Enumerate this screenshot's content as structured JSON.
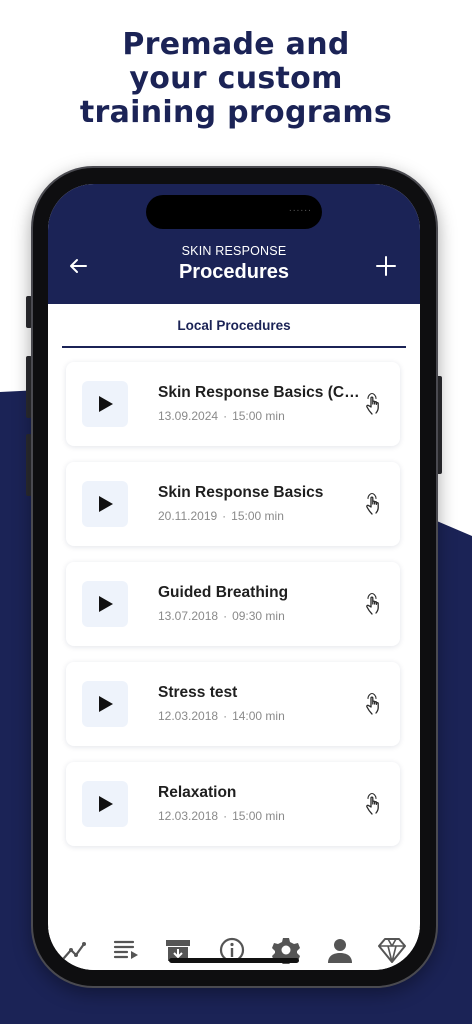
{
  "headline": [
    "Premade and",
    "your custom",
    "training programs"
  ],
  "header": {
    "subtitle": "SKIN RESPONSE",
    "title": "Procedures",
    "back_icon": "arrow-left-icon",
    "add_icon": "plus-icon"
  },
  "tabs": [
    {
      "label": "Local Procedures",
      "selected": true
    }
  ],
  "procedures": [
    {
      "title": "Skin Response Basics (CO...",
      "date": "13.09.2024",
      "duration": "15:00 min"
    },
    {
      "title": "Skin Response Basics",
      "date": "20.11.2019",
      "duration": "15:00 min"
    },
    {
      "title": "Guided Breathing",
      "date": "13.07.2018",
      "duration": "09:30 min"
    },
    {
      "title": "Stress test",
      "date": "12.03.2018",
      "duration": "14:00 min"
    },
    {
      "title": "Relaxation",
      "date": "12.03.2018",
      "duration": "15:00 min"
    }
  ],
  "meta_separator": "·",
  "bottom_nav": [
    "trend-icon",
    "playlist-icon",
    "archive-icon",
    "info-icon",
    "settings-icon",
    "profile-icon",
    "diamond-icon"
  ],
  "colors": {
    "navy": "#1b2356",
    "card_play_bg": "#eef3fb",
    "meta_text": "#8a8a8a"
  }
}
